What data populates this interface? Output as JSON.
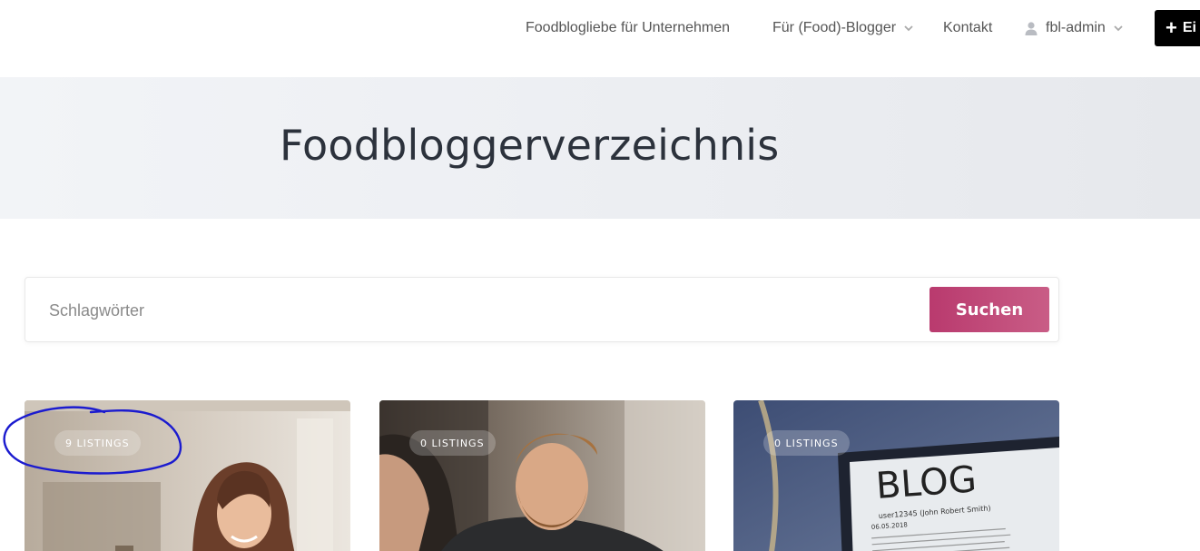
{
  "nav": {
    "items": [
      {
        "label": "Foodblogliebe für Unternehmen"
      },
      {
        "label": "Für (Food)-Blogger"
      },
      {
        "label": "Kontakt"
      },
      {
        "label": "fbl-admin"
      }
    ],
    "add_button_label": "Ei"
  },
  "hero": {
    "title": "Foodbloggerverzeichnis"
  },
  "search": {
    "placeholder": "Schlagwörter",
    "button_label": "Suchen"
  },
  "cards": [
    {
      "badge": "9 LISTINGS"
    },
    {
      "badge": "0 LISTINGS"
    },
    {
      "badge": "0 LISTINGS",
      "image_text": "BLOG",
      "image_line": "user12345 (John Robert Smith)",
      "image_date": "06.05.2018"
    }
  ],
  "colors": {
    "accent": "#b93a6e",
    "annotation": "#1b1bcf"
  }
}
